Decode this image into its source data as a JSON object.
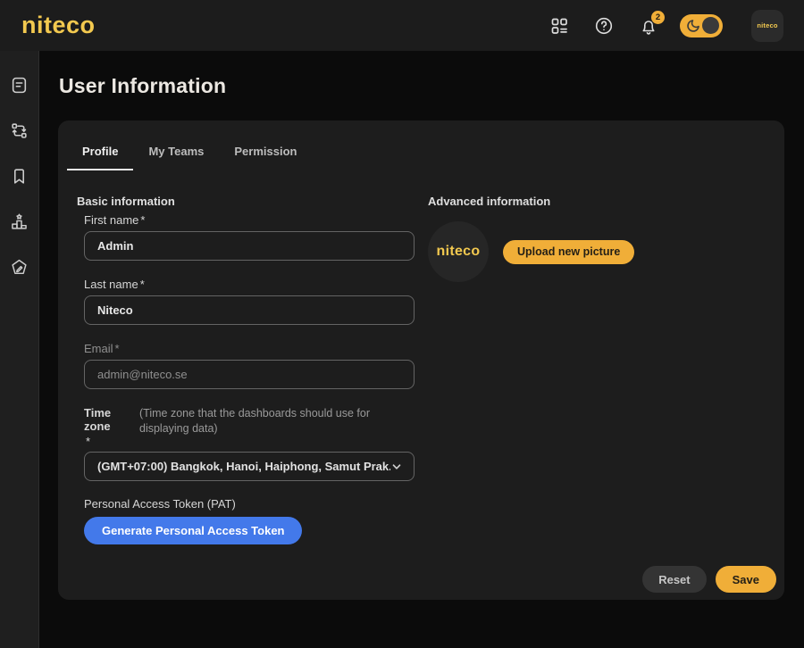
{
  "colors": {
    "brand_yellow": "#F3C94F",
    "accent_amber": "#F0AE38",
    "primary_blue": "#4379EA",
    "page_bg": "#0B0B0B",
    "card_bg": "#1D1D1D"
  },
  "header": {
    "logo": "niteco",
    "icons": {
      "apps": "apps-grid-icon",
      "help": "help-circle-icon",
      "bell": "notification-bell-icon",
      "theme_toggle": "moon-icon"
    },
    "notification_count": "2",
    "theme_toggle_state": "on",
    "avatar_label": "niteco"
  },
  "sidebar": {
    "items": [
      {
        "icon": "report-document-icon"
      },
      {
        "icon": "workflow-transfer-icon"
      },
      {
        "icon": "bookmark-icon"
      },
      {
        "icon": "leaderboard-podium-icon"
      },
      {
        "icon": "edit-pen-icon"
      }
    ]
  },
  "page": {
    "title": "User Information"
  },
  "tabs": [
    {
      "label": "Profile",
      "active": true
    },
    {
      "label": "My Teams",
      "active": false
    },
    {
      "label": "Permission",
      "active": false
    }
  ],
  "basic": {
    "heading": "Basic information",
    "first_name": {
      "label": "First name",
      "required_mark": "*",
      "value": "Admin"
    },
    "last_name": {
      "label": "Last name",
      "required_mark": "*",
      "value": "Niteco"
    },
    "email": {
      "label": "Email",
      "required_mark": "*",
      "value": "admin@niteco.se"
    },
    "time_zone": {
      "label": "Time zone",
      "required_mark": "*",
      "hint": "(Time zone that the dashboards should use for displaying data)",
      "value": "(GMT+07:00) Bangkok, Hanoi, Haiphong, Samut Prak..."
    },
    "pat": {
      "label": "Personal Access Token (PAT)",
      "button_label": "Generate Personal Access Token"
    }
  },
  "advanced": {
    "heading": "Advanced information",
    "avatar_label": "niteco",
    "upload_button_label": "Upload new picture"
  },
  "footer": {
    "reset_label": "Reset",
    "save_label": "Save"
  }
}
